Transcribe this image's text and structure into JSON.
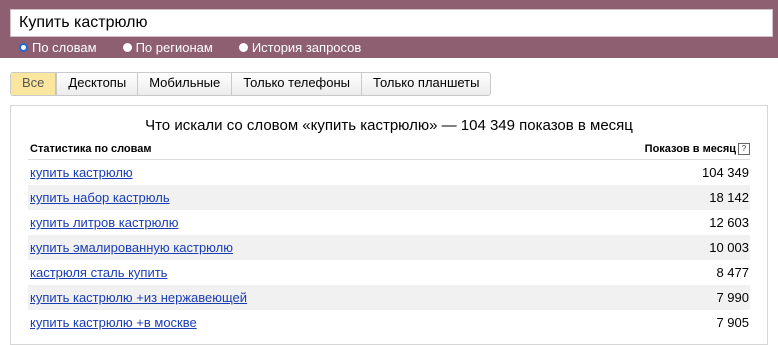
{
  "search": {
    "query": "Купить кастрюлю"
  },
  "modes": [
    {
      "label": "По словам",
      "checked": true
    },
    {
      "label": "По регионам",
      "checked": false
    },
    {
      "label": "История запросов",
      "checked": false
    }
  ],
  "filters": [
    {
      "label": "Все",
      "active": true
    },
    {
      "label": "Десктопы",
      "active": false
    },
    {
      "label": "Мобильные",
      "active": false
    },
    {
      "label": "Только телефоны",
      "active": false
    },
    {
      "label": "Только планшеты",
      "active": false
    }
  ],
  "panel": {
    "title": "Что искали со словом «купить кастрюлю» — 104 349 показов в месяц",
    "col_left": "Статистика по словам",
    "col_right": "Показов в месяц",
    "help_glyph": "?"
  },
  "rows": [
    {
      "phrase": "купить кастрюлю",
      "count": "104 349"
    },
    {
      "phrase": "купить набор кастрюль",
      "count": "18 142"
    },
    {
      "phrase": "купить литров кастрюлю",
      "count": "12 603"
    },
    {
      "phrase": "купить эмалированную кастрюлю",
      "count": "10 003"
    },
    {
      "phrase": "кастрюля сталь купить",
      "count": "8 477"
    },
    {
      "phrase": "купить кастрюлю +из нержавеющей",
      "count": "7 990"
    },
    {
      "phrase": "купить кастрюлю +в москве",
      "count": "7 905"
    }
  ],
  "colors": {
    "band": "#8d5f70",
    "link": "#1a3db3",
    "active_filter": "#fbe6a0"
  }
}
